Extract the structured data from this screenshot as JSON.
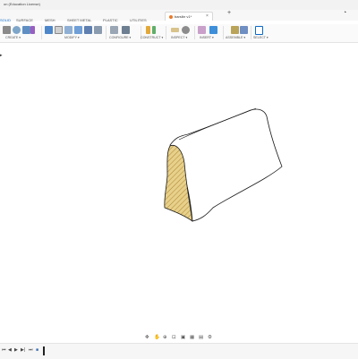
{
  "window": {
    "title_partial": "on (Education License)",
    "document_tab": "barslbr v1*"
  },
  "workspace_tabs": [
    "SOLID",
    "SURFACE",
    "MESH",
    "SHEET METAL",
    "PLASTIC",
    "UTILITIES"
  ],
  "active_tab_index": 0,
  "toolbar_groups": [
    "CREATE",
    "MODIFY",
    "CONFIGURE",
    "CONSTRUCT",
    "INSPECT",
    "INSERT",
    "ASSEMBLE",
    "SELECT"
  ],
  "icons": {
    "window_controls": [
      "minimize-icon",
      "maximize-icon",
      "close-icon"
    ],
    "new_tab": "plus-icon",
    "browser": "chevron-right-icon",
    "navigation": [
      "orbit-icon",
      "pan-icon",
      "zoom-icon",
      "fit-icon",
      "display-icon",
      "grid-icon",
      "viewports-icon"
    ],
    "timeline": [
      "first-icon",
      "previous-icon",
      "play-icon",
      "next-icon",
      "last-icon",
      "feature-icon",
      "marker-icon"
    ]
  },
  "colors": {
    "accent": "#0a6ac9",
    "hatch": "#d6b35a",
    "model_edge": "#1a1a1a",
    "canvas": "#ffffff"
  }
}
